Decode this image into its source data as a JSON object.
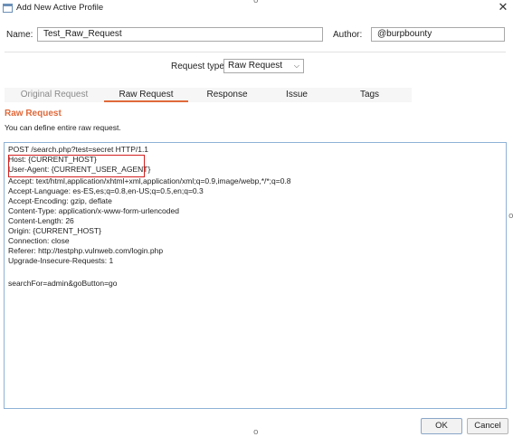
{
  "window": {
    "title": "Add New Active Profile",
    "close_icon": "close-icon",
    "edge_mark": "o"
  },
  "form": {
    "name_label": "Name:",
    "name_value": "Test_Raw_Request",
    "author_label": "Author:",
    "author_value": "@burpbounty"
  },
  "request_type": {
    "label": "Request type",
    "selected": "Raw Request",
    "icon": "chevron-down-icon"
  },
  "tabs": [
    {
      "label": "Original Request",
      "state": "disabled"
    },
    {
      "label": "Raw Request",
      "state": "active"
    },
    {
      "label": "Response",
      "state": "normal"
    },
    {
      "label": "Issue",
      "state": "normal"
    },
    {
      "label": "Tags",
      "state": "normal"
    }
  ],
  "section": {
    "title": "Raw Request",
    "description": "You can define entire raw request."
  },
  "raw_request": {
    "lines": [
      "POST /search.php?test=secret HTTP/1.1",
      "Host: {CURRENT_HOST}",
      "User-Agent: {CURRENT_USER_AGENT}",
      "Accept: text/html,application/xhtml+xml,application/xml;q=0.9,image/webp,*/*;q=0.8",
      "Accept-Language: es-ES,es;q=0.8,en-US;q=0.5,en;q=0.3",
      "Accept-Encoding: gzip, deflate",
      "Content-Type: application/x-www-form-urlencoded",
      "Content-Length: 26",
      "Origin: {CURRENT_HOST}",
      "Connection: close",
      "Referer: http://testphp.vulnweb.com/login.php",
      "Upgrade-Insecure-Requests: 1",
      "",
      "searchFor=admin&goButton=go"
    ],
    "highlight_color": "#d32020"
  },
  "buttons": {
    "ok": "OK",
    "cancel": "Cancel"
  },
  "colors": {
    "accent": "#e0693a",
    "editor_border": "#8fb2d6"
  }
}
